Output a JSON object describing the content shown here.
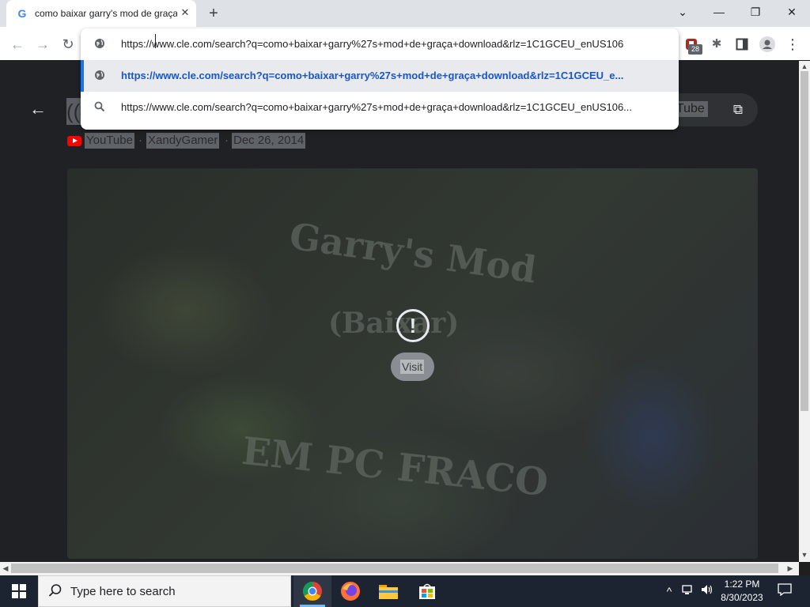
{
  "tab": {
    "title": "como baixar garry's mod de graça",
    "favicon": "G",
    "close_glyph": "✕"
  },
  "new_tab_glyph": "+",
  "window_controls": {
    "dropdown": "⌄",
    "minimize": "—",
    "restore": "❐",
    "close": "✕"
  },
  "omnibox": {
    "value": "https://www.cle.com/search?q=como+baixar+garry%27s+mod+de+graça+download&rlz=1C1GCEU_enUS106",
    "suggestions": [
      {
        "icon": "globe-icon",
        "text": "https://www.cle.com/search?q=como+baixar+garry%27s+mod+de+graça+download&rlz=1C1GCEU_e..."
      },
      {
        "icon": "search-icon",
        "text": "https://www.cle.com/search?q=como+baixar+garry%27s+mod+de+graça+download&rlz=1C1GCEU_enUS106..."
      }
    ]
  },
  "extensions": {
    "badge_count": "28"
  },
  "video": {
    "title_fragment": "((",
    "source": "YouTube",
    "separator": "·",
    "author": "XandyGamer",
    "date": "Dec 26, 2014",
    "open_label": "uTube",
    "visit_label": "Visit",
    "thumbnail_text_1": "Garry's Mod",
    "thumbnail_text_2": "(Baixar)",
    "thumbnail_text_3": "EM PC FRACO"
  },
  "taskbar": {
    "search_placeholder": "Type here to search",
    "time": "1:22 PM",
    "date": "8/30/2023"
  },
  "colors": {
    "accent": "#1a73e8",
    "page_background": "#202124",
    "taskbar": "#1c2331"
  }
}
